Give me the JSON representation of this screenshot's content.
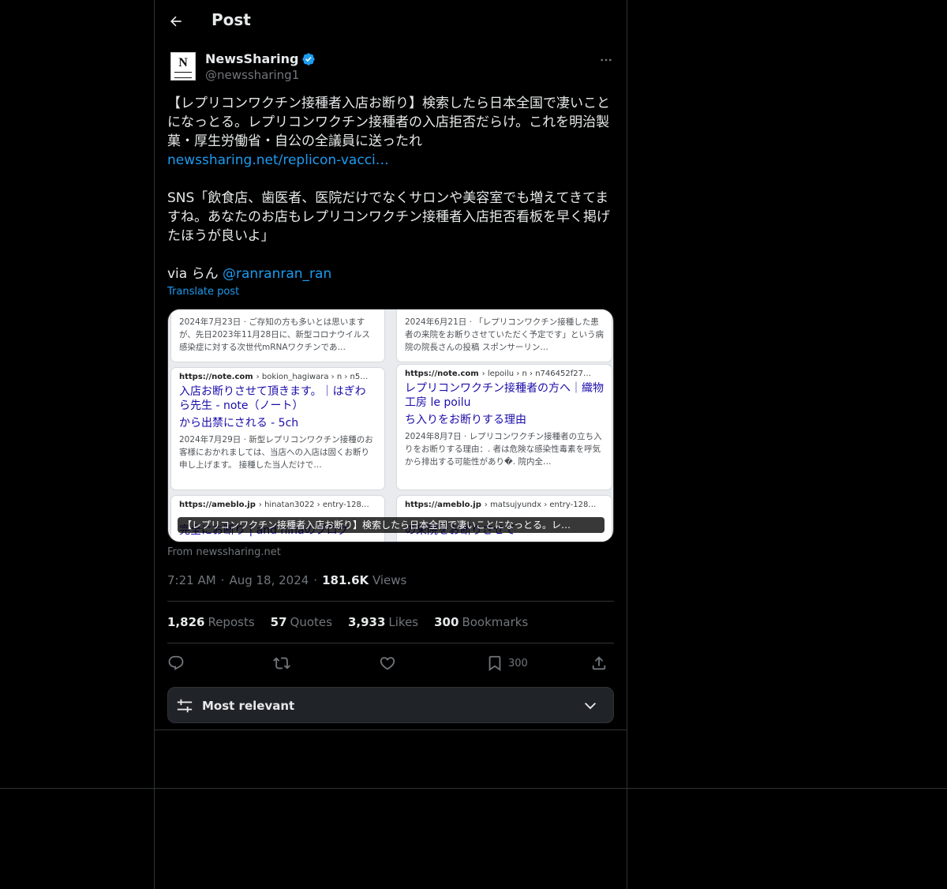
{
  "header": {
    "title": "Post"
  },
  "author": {
    "avatar_letter": "N",
    "name": "NewsSharing",
    "handle": "@newssharing1",
    "verified": true
  },
  "post": {
    "text_line1": "【レプリコンワクチン接種者入店お断り】検索したら日本全国で凄いことになっとる。レプリコンワクチン接種者の入店拒否だらけ。これを明治製菓・厚生労働省・自公の全議員に送ったれ",
    "link": "newssharing.net/replicon-vacci…",
    "text_para2": "SNS「飲食店、歯医者、医院だけでなくサロンや美容室でも増えてきてますね。あなたのお店もレプリコンワクチン接種者入店拒否看板を早く掲げたほうが良いよ」",
    "via_prefix": "via らん ",
    "via_mention": "@ranranran_ran",
    "translate_label": "Translate post"
  },
  "media": {
    "caption": "【レプリコンワクチン接種者入店お断り】検索したら日本全国で凄いことになっとる。レ…",
    "cards": [
      {
        "url_host": "",
        "url_path": "",
        "title": "",
        "desc": "2024年7月23日 · ご存知の方も多いとは思いますが、先日2023年11月28日に、新型コロナウイルス感染症に対する次世代mRNAワクチンであ…"
      },
      {
        "url_host": "",
        "url_path": "",
        "title": "",
        "desc": "2024年6月21日 · 「レプリコンワクチン接種した患者の来院をお断りさせていただく予定です」という病院の院長さんの投稿 スポンサーリン…"
      },
      {
        "url_host": "https://note.com",
        "url_path": "› bokion_hagiwara › n › n5…",
        "title": "入店お断りさせて頂きます。｜はぎわら先生 - note（ノート）",
        "title2": "から出禁にされる - 5ch",
        "desc": "2024年7月29日 · 新型レプリコンワクチン接種のお客様におかれましては、当店への入店は固くお断り申し上げます。 接種した当人だけで…"
      },
      {
        "url_host": "https://note.com",
        "url_path": "› lepoilu › n › n746452f27…",
        "title": "レプリコンワクチン接種者の方へ｜織物工房 le poilu",
        "title2": "ち入りをお断りする理由",
        "desc": "2024年8月7日 · レプリコンワクチン接種者の立ち入りをお断りする理由：. 者は危険な感染性毒素を呼気から排出する可能性があり�. 院内全…"
      },
      {
        "url_host": "https://ameblo.jp",
        "url_path": "› hinatan3022 › entry-128…",
        "title": "完全にお断り | and hinaのブログ",
        "desc": ""
      },
      {
        "url_host": "https://ameblo.jp",
        "url_path": "› matsujyundx › entry-128…",
        "title": "の来院をお断りさせて",
        "desc": ""
      }
    ]
  },
  "source": {
    "label": "From newssharing.net"
  },
  "meta": {
    "time": "7:21 AM",
    "date": "Aug 18, 2024",
    "views_count": "181.6K",
    "views_label": "Views",
    "sep": "·"
  },
  "stats": [
    {
      "num": "1,826",
      "label": "Reposts"
    },
    {
      "num": "57",
      "label": "Quotes"
    },
    {
      "num": "3,933",
      "label": "Likes"
    },
    {
      "num": "300",
      "label": "Bookmarks"
    }
  ],
  "actions": {
    "bookmark_count": "300"
  },
  "sort": {
    "label": "Most relevant"
  },
  "colors": {
    "accent": "#1d9bf0",
    "background": "#000000",
    "border": "#2f3336",
    "muted": "#71767b"
  }
}
